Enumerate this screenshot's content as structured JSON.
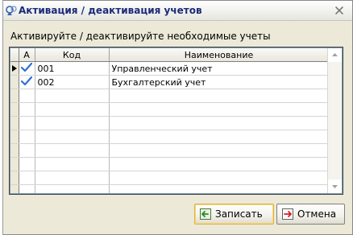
{
  "window": {
    "title": "Активация / деактивация учетов",
    "close_icon": "close-icon",
    "title_icon": "accounts-icon"
  },
  "subtitle": "Активируйте / деактивируйте необходимые учеты",
  "grid": {
    "columns": {
      "active": "А",
      "code": "Код",
      "name": "Наименование"
    },
    "rows": [
      {
        "current": true,
        "active": true,
        "code": "001",
        "name": "Управленческий учет"
      },
      {
        "current": false,
        "active": true,
        "code": "002",
        "name": "Бухгалтерский учет"
      }
    ]
  },
  "buttons": {
    "save_label": "Записать",
    "cancel_label": "Отмена"
  },
  "colors": {
    "title_text": "#1b2a7a",
    "check": "#2f6fd6",
    "window_bg": "#ece9d8"
  }
}
